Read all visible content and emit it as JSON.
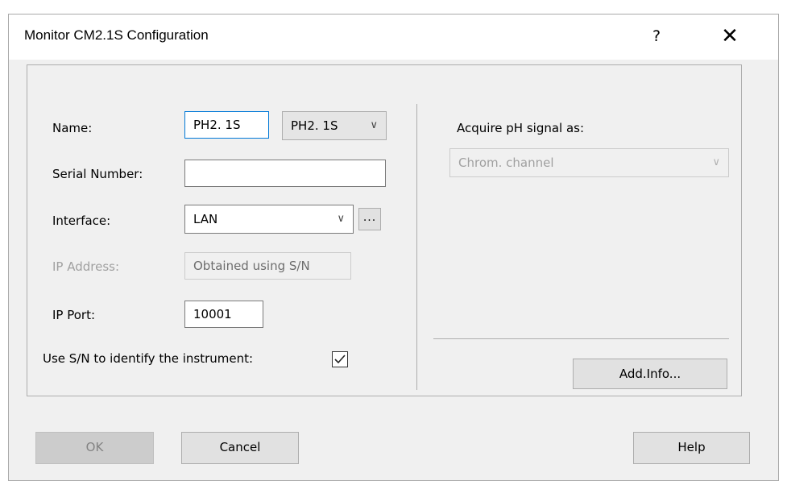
{
  "window": {
    "title": "Monitor CM2.1S Configuration",
    "help_glyph": "?",
    "close_glyph": "✕"
  },
  "form": {
    "name_label": "Name:",
    "name_value": "PH2. 1S",
    "name_combo_value": "PH2. 1S",
    "serial_label": "Serial Number:",
    "serial_value": "",
    "interface_label": "Interface:",
    "interface_value": "LAN",
    "interface_more_label": "...",
    "ip_address_label": "IP Address:",
    "ip_address_value": "Obtained using S/N",
    "ip_port_label": "IP Port:",
    "ip_port_value": "10001",
    "use_sn_label": "Use S/N to identify the instrument:",
    "use_sn_checked": true
  },
  "right_panel": {
    "acquire_label": "Acquire pH signal as:",
    "acquire_value": "Chrom. channel",
    "add_info_label": "Add.Info..."
  },
  "buttons": {
    "ok": "OK",
    "cancel": "Cancel",
    "help": "Help"
  },
  "colors": {
    "dialog_bg": "#f0f0f0",
    "focus_border": "#0078d7",
    "disabled_text": "#a0a0a0"
  }
}
